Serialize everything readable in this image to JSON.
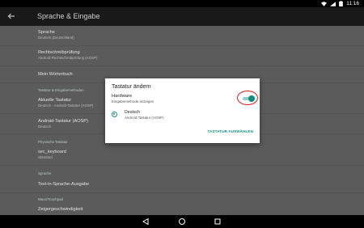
{
  "colors": {
    "accent": "#128c7e",
    "statusbar": "#000000",
    "appbar": "#191919",
    "dim_background": "#5b5b5b",
    "dialog": "#ffffff",
    "annotation": "#e21e1e"
  },
  "statusbar": {
    "time": "11:16"
  },
  "appbar": {
    "title": "Sprache & Eingabe"
  },
  "settings": [
    {
      "title": "Sprache",
      "summary": "Deutsch (Deutschland)"
    },
    {
      "title": "Rechtschreibprüfung",
      "summary": "Android-Rechtschreibprüfung (AOSP)"
    },
    {
      "title": "Mein Wörterbuch"
    },
    {
      "section": "Tastatur & Eingabemethoden"
    },
    {
      "title": "Aktuelle Tastatur",
      "summary": "Deutsch - Android-Tastatur (AOSP)"
    },
    {
      "title": "Android-Tastatur (AOSP)",
      "summary": "Deutsch"
    },
    {
      "section": "Physische Tastatur"
    },
    {
      "title": "sec_keyboard",
      "summary": "Standard"
    },
    {
      "section": "Sprache"
    },
    {
      "title": "Text-in-Sprache-Ausgabe"
    },
    {
      "section": "Maus/Touchpad"
    },
    {
      "title": "Zeigergeschwindigkeit"
    }
  ],
  "dialog": {
    "title": "Tastatur ändern",
    "hardware_label": "Hardware",
    "hardware_summary": "Eingabemethode anzeigen",
    "hardware_toggle_on": true,
    "options": [
      {
        "label": "Deutsch",
        "summary": "Android-Tastatur (AOSP)",
        "selected": true
      }
    ],
    "action": "TASTATUR AUSWÄHLEN"
  },
  "navbar": {
    "icons": [
      "back-icon",
      "home-icon",
      "recents-icon"
    ]
  }
}
